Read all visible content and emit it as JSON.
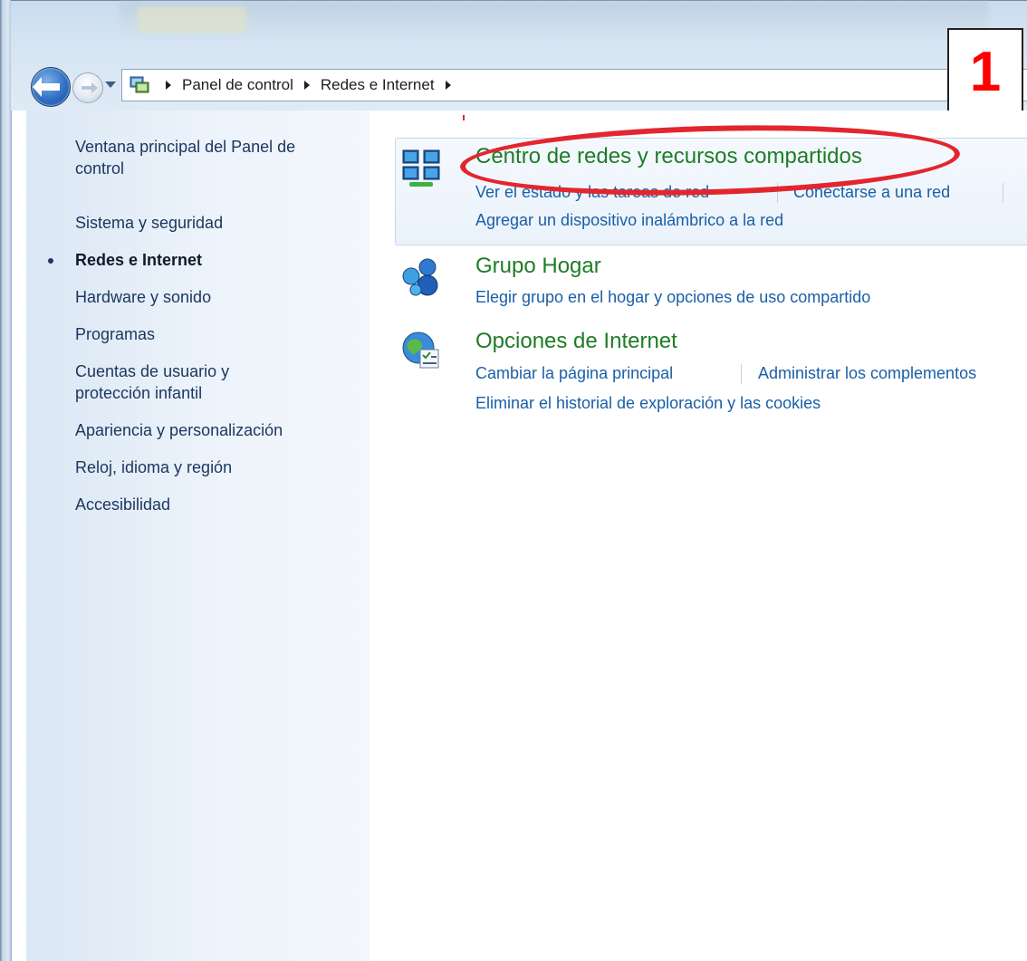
{
  "breadcrumb": [
    "Panel de control",
    "Redes e Internet"
  ],
  "annotation_number": "1",
  "sidebar": {
    "items": [
      {
        "label": "Ventana principal del Panel de control",
        "lines": [
          "Ventana principal del Panel de",
          "control"
        ]
      },
      {
        "label": "Sistema y seguridad"
      },
      {
        "label": "Redes e Internet",
        "active": true
      },
      {
        "label": "Hardware y sonido"
      },
      {
        "label": "Programas"
      },
      {
        "label": "Cuentas de usuario y protección infantil",
        "lines": [
          "Cuentas de usuario y",
          "protección infantil"
        ]
      },
      {
        "label": "Apariencia y personalización"
      },
      {
        "label": "Reloj, idioma y región"
      },
      {
        "label": "Accesibilidad"
      }
    ]
  },
  "categories": [
    {
      "title": "Centro de redes y recursos compartidos",
      "icon": "network-center-icon",
      "links": [
        "Ver el estado y las tareas de red",
        "Conectarse a una red",
        "Agregar un dispositivo inalámbrico a la red"
      ]
    },
    {
      "title": "Grupo Hogar",
      "icon": "homegroup-icon",
      "links": [
        "Elegir grupo en el hogar y opciones de uso compartido"
      ]
    },
    {
      "title": "Opciones de Internet",
      "icon": "internet-options-icon",
      "links": [
        "Cambiar la página principal",
        "Administrar los complementos",
        "Eliminar el historial de exploración y las cookies"
      ]
    }
  ],
  "colors": {
    "category_title": "#1e7d26",
    "link": "#1a5fa8",
    "annotation": "#e3262e"
  }
}
